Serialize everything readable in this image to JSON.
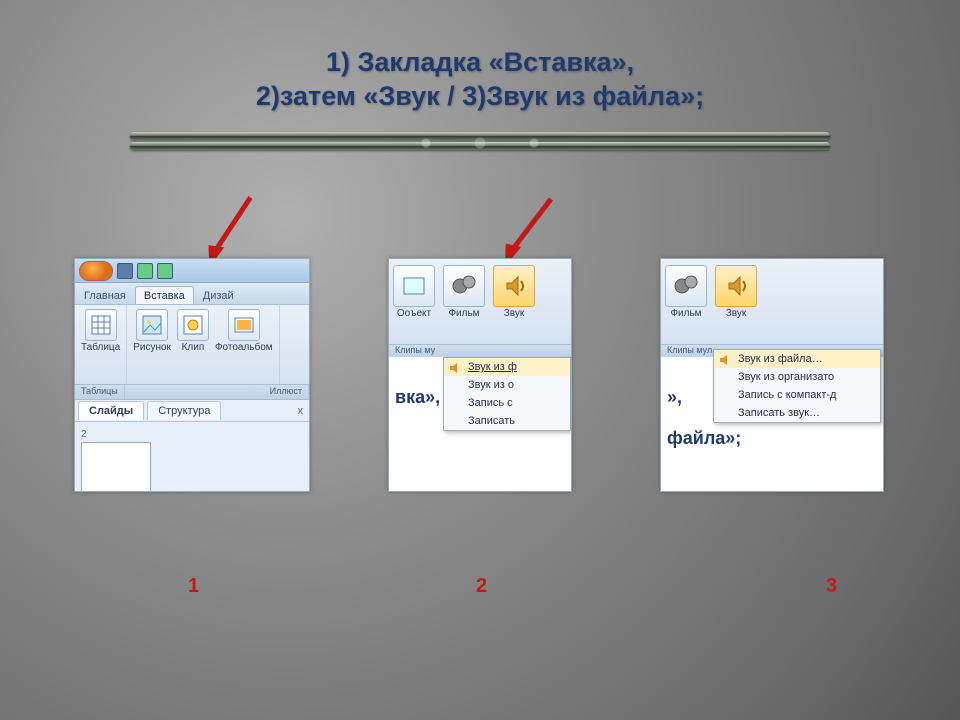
{
  "title_line1": "1) Закладка «Вставка»,",
  "title_line2": "2)затем  «Звук / 3)Звук из файла»;",
  "captions": {
    "c1": "1",
    "c2": "2",
    "c3": "3"
  },
  "panel1": {
    "tabs": {
      "home": "Главная",
      "insert": "Вставка",
      "design": "Дизай"
    },
    "ribbon": {
      "table": "Таблица",
      "picture": "Рисунок",
      "clip": "Клип",
      "photoalbum": "Фотоальбом"
    },
    "group_labels": {
      "left": "Таблицы",
      "right": "Иллюст"
    },
    "nav": {
      "slides": "Слайды",
      "structure": "Структура",
      "close": "x"
    },
    "slide_number": "2"
  },
  "panel2": {
    "ribbon": {
      "object": "Ооъект",
      "movie": "Фильм",
      "sound": "Звук"
    },
    "group_label": "Клипы му",
    "menu": {
      "from_file": "Звук из ф",
      "from_org": "Звук из о",
      "record_cd": "Запись с",
      "record": "Записать"
    },
    "doc_fragment": "вка»,"
  },
  "panel3": {
    "ribbon": {
      "movie": "Фильм",
      "sound": "Звук"
    },
    "group_label": "Клипы мул",
    "menu": {
      "from_file": "Звук из файла…",
      "from_org": "Звук из организато",
      "record_cd": "Запись с компакт-д",
      "record": "Записать звук…"
    },
    "doc_fragment1": "»,",
    "doc_fragment2": "файла»;"
  }
}
